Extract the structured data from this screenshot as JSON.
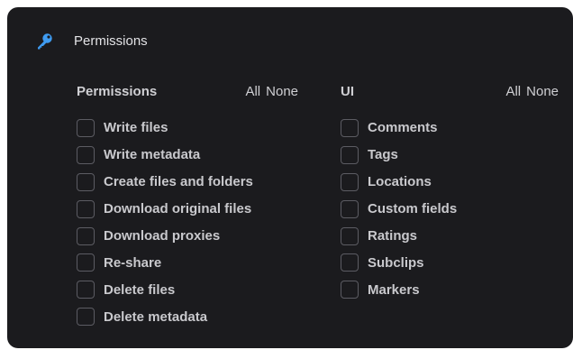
{
  "header": {
    "title": "Permissions",
    "icon": "key-icon",
    "icon_color": "#3f9cf2"
  },
  "permissions": {
    "title": "Permissions",
    "all_label": "All",
    "none_label": "None",
    "items": [
      {
        "label": "Write files",
        "checked": false
      },
      {
        "label": "Write metadata",
        "checked": false
      },
      {
        "label": "Create files and folders",
        "checked": false
      },
      {
        "label": "Download original files",
        "checked": false
      },
      {
        "label": "Download proxies",
        "checked": false
      },
      {
        "label": "Re-share",
        "checked": false
      },
      {
        "label": "Delete files",
        "checked": false
      },
      {
        "label": "Delete metadata",
        "checked": false
      }
    ]
  },
  "ui": {
    "title": "UI",
    "all_label": "All",
    "none_label": "None",
    "items": [
      {
        "label": "Comments",
        "checked": false
      },
      {
        "label": "Tags",
        "checked": false
      },
      {
        "label": "Locations",
        "checked": false
      },
      {
        "label": "Custom fields",
        "checked": false
      },
      {
        "label": "Ratings",
        "checked": false
      },
      {
        "label": "Subclips",
        "checked": false
      },
      {
        "label": "Markers",
        "checked": false
      }
    ]
  },
  "colors": {
    "panel_background": "#1b1b1e",
    "text": "#c9c9cd",
    "checkbox_border": "#5c5c63"
  }
}
